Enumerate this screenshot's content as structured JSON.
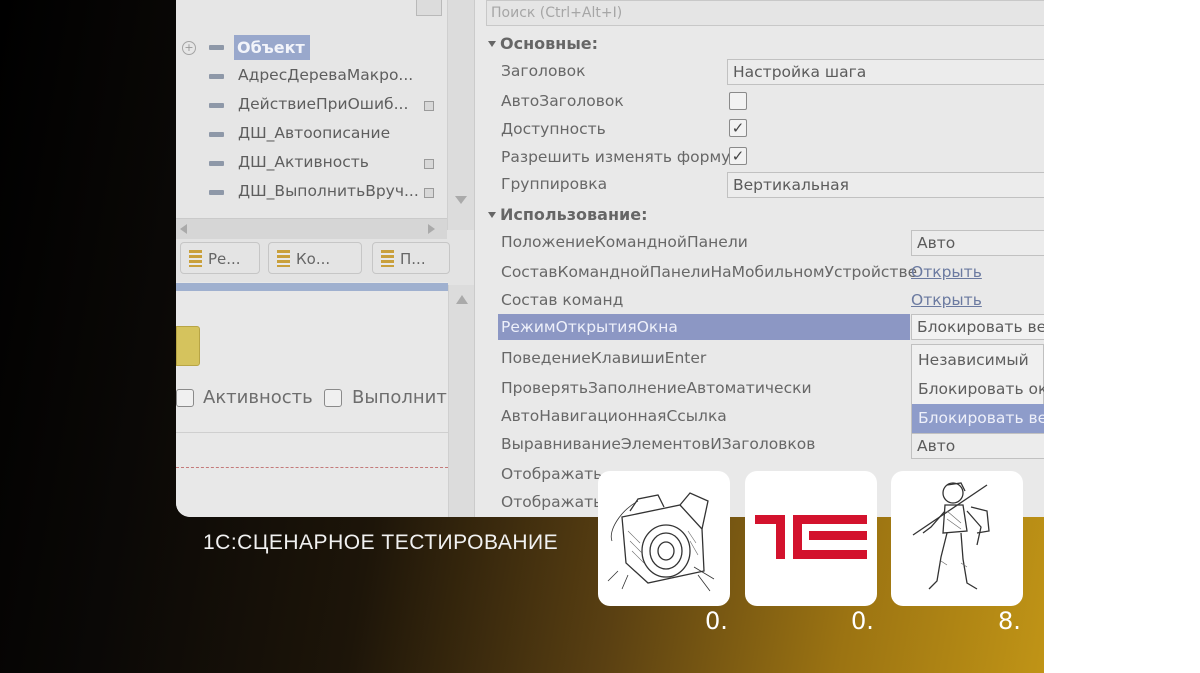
{
  "left_panel": {
    "tree_items": [
      {
        "label": "Объект"
      },
      {
        "label": "АдресДереваМакро..."
      },
      {
        "label": "ДействиеПриОшиб..."
      },
      {
        "label": "ДШ_Автоописание"
      },
      {
        "label": "ДШ_Активность"
      },
      {
        "label": "ДШ_ВыполнитьВруч..."
      }
    ],
    "tabs": [
      "Ре...",
      "Ко...",
      "П..."
    ],
    "form_checkboxes": [
      "Активность",
      "Выполнить"
    ]
  },
  "properties": {
    "search_placeholder": "Поиск (Ctrl+Alt+I)",
    "section_main": "Основные:",
    "section_usage": "Использование:",
    "rows": {
      "title_label": "Заголовок",
      "title_value": "Настройка шага",
      "auto_title_label": "АвтоЗаголовок",
      "enabled_label": "Доступность",
      "allow_change_label": "Разрешить изменять форму",
      "grouping_label": "Группировка",
      "grouping_value": "Вертикальная",
      "cmd_panel_pos_label": "ПоложениеКоманднойПанели",
      "cmd_panel_pos_value": "Авто",
      "cmd_panel_mobile_label": "СоставКоманднойПанелиНаМобильномУстройстве",
      "cmd_panel_mobile_link": "Открыть",
      "commands_label": "Состав команд",
      "commands_link": "Открыть",
      "window_mode_label": "РежимОткрытияОкна",
      "window_mode_value": "Блокировать вес",
      "enter_label": "ПоведениеКлавишиEnter",
      "auto_check_label": "ПроверятьЗаполнениеАвтоматически",
      "auto_nav_label": "АвтоНавигационнаяСсылка",
      "align_label": "ВыравниваниеЭлементовИЗаголовков",
      "align_value": "Авто",
      "display1_label": "Отображать",
      "display2_label": "Отображать"
    },
    "checkbox_states": {
      "auto_title": false,
      "enabled": true,
      "allow_change": true
    },
    "dropdown_options": [
      "Независимый",
      "Блокировать окн",
      "Блокировать вес"
    ],
    "dropdown_selected": "Блокировать вес"
  },
  "overlay": {
    "caption": "1С:СЦЕНАРНОЕ ТЕСТИРОВАНИЕ",
    "cards": [
      {
        "icon": "camera-sketch-icon",
        "number": "0."
      },
      {
        "icon": "1c-logo-icon",
        "number": "0.",
        "color": "#d3122d"
      },
      {
        "icon": "robot-sketch-icon",
        "number": "8."
      }
    ]
  },
  "colors": {
    "accent_gold": "#c09416",
    "selection": "#8c97c4",
    "logo_red": "#d3122d"
  }
}
